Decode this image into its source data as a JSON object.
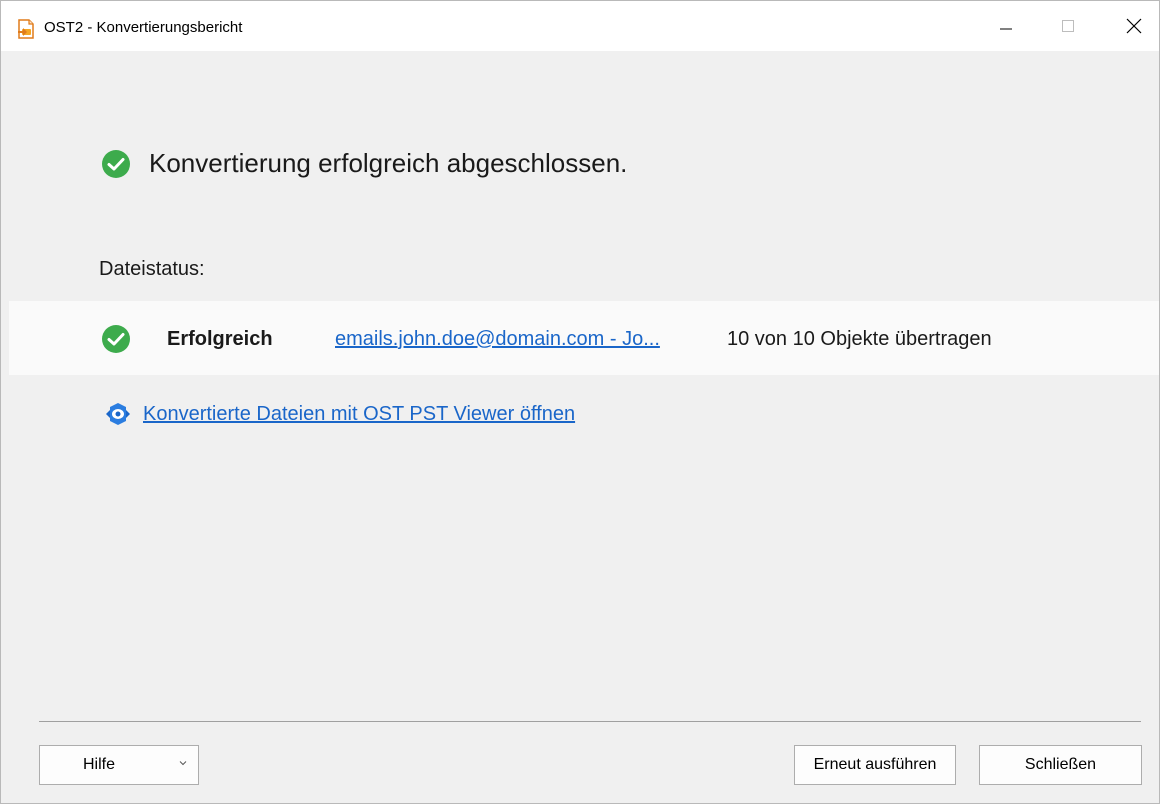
{
  "window": {
    "title": "OST2 - Konvertierungsbericht",
    "controls": {
      "minimize": "minimize-icon",
      "maximize": "maximize-icon",
      "close": "close-icon"
    }
  },
  "result": {
    "headline": "Konvertierung erfolgreich abgeschlossen.",
    "icon": "success-check-icon",
    "color": "#3dab4c"
  },
  "file_status": {
    "label": "Dateistatus:",
    "rows": [
      {
        "status": "Erfolgreich",
        "file": "emails.john.doe@domain.com - Jo...",
        "count": "10 von 10 Objekte übertragen"
      }
    ]
  },
  "viewer_link": {
    "text": "Konvertierte Dateien mit OST PST Viewer öffnen",
    "icon": "viewer-eye-icon"
  },
  "footer": {
    "help_label": "Hilfe",
    "rerun_label": "Erneut ausführen",
    "close_label": "Schließen"
  },
  "colors": {
    "link": "#1a66c9",
    "success": "#3dab4c",
    "background": "#f0f0f0"
  }
}
